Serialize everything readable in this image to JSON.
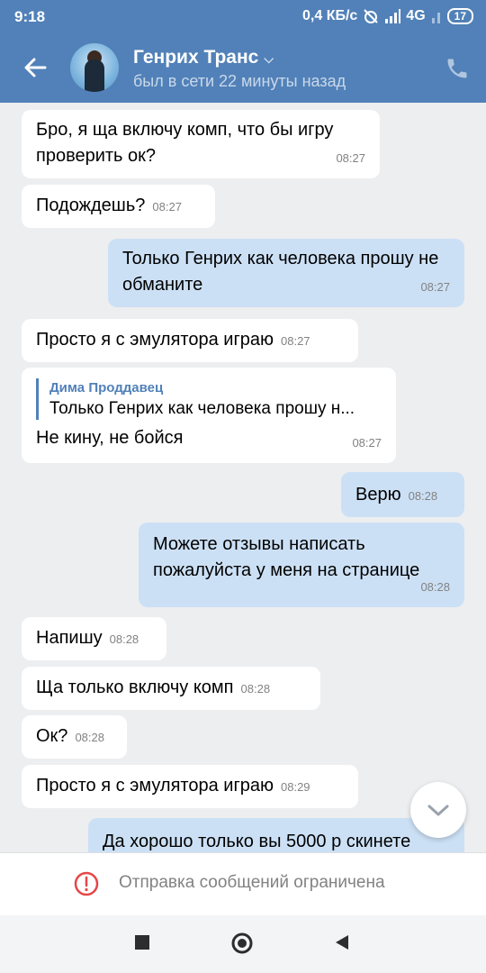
{
  "status": {
    "time": "9:18",
    "speed": "0,4 КБ/с",
    "network": "4G",
    "battery": "17"
  },
  "header": {
    "contact_name": "Генрих Транс",
    "last_seen": "был в сети 22 минуты назад"
  },
  "messages": [
    {
      "text": "Бро, я ща включу комп, что бы игру проверить ок?",
      "time": "08:27"
    },
    {
      "text": "Подождешь?",
      "time": "08:27"
    },
    {
      "text": "Только Генрих как человека прошу не обманите",
      "time": "08:27"
    },
    {
      "text": "Просто я с эмулятора играю",
      "time": "08:27"
    },
    {
      "reply_author": "Дима Проддавец",
      "reply_text": "Только Генрих как человека прошу н...",
      "text": "Не кину, не бойся",
      "time": "08:27"
    },
    {
      "text": "Верю",
      "time": "08:28"
    },
    {
      "text": "Можете отзывы написать пожалуйста у меня на странице",
      "time": "08:28"
    },
    {
      "text": "Напишу",
      "time": "08:28"
    },
    {
      "text": "Ща только включу комп",
      "time": "08:28"
    },
    {
      "text": "Ок?",
      "time": "08:28"
    },
    {
      "text": "Просто я с эмулятора играю",
      "time": "08:29"
    },
    {
      "text": "Да хорошо только вы 5000 р скинете"
    }
  ],
  "restriction": {
    "text": "Отправка сообщений ограничена"
  },
  "icons": {
    "back": "arrow-left-icon",
    "phone": "phone-icon",
    "scroll": "chevron-down-icon",
    "warning": "exclamation-circle-icon"
  },
  "colors": {
    "header": "#5181b8",
    "incoming": "#ffffff",
    "outgoing": "#cce0f5",
    "background": "#edeef0",
    "warning": "#e64646"
  }
}
